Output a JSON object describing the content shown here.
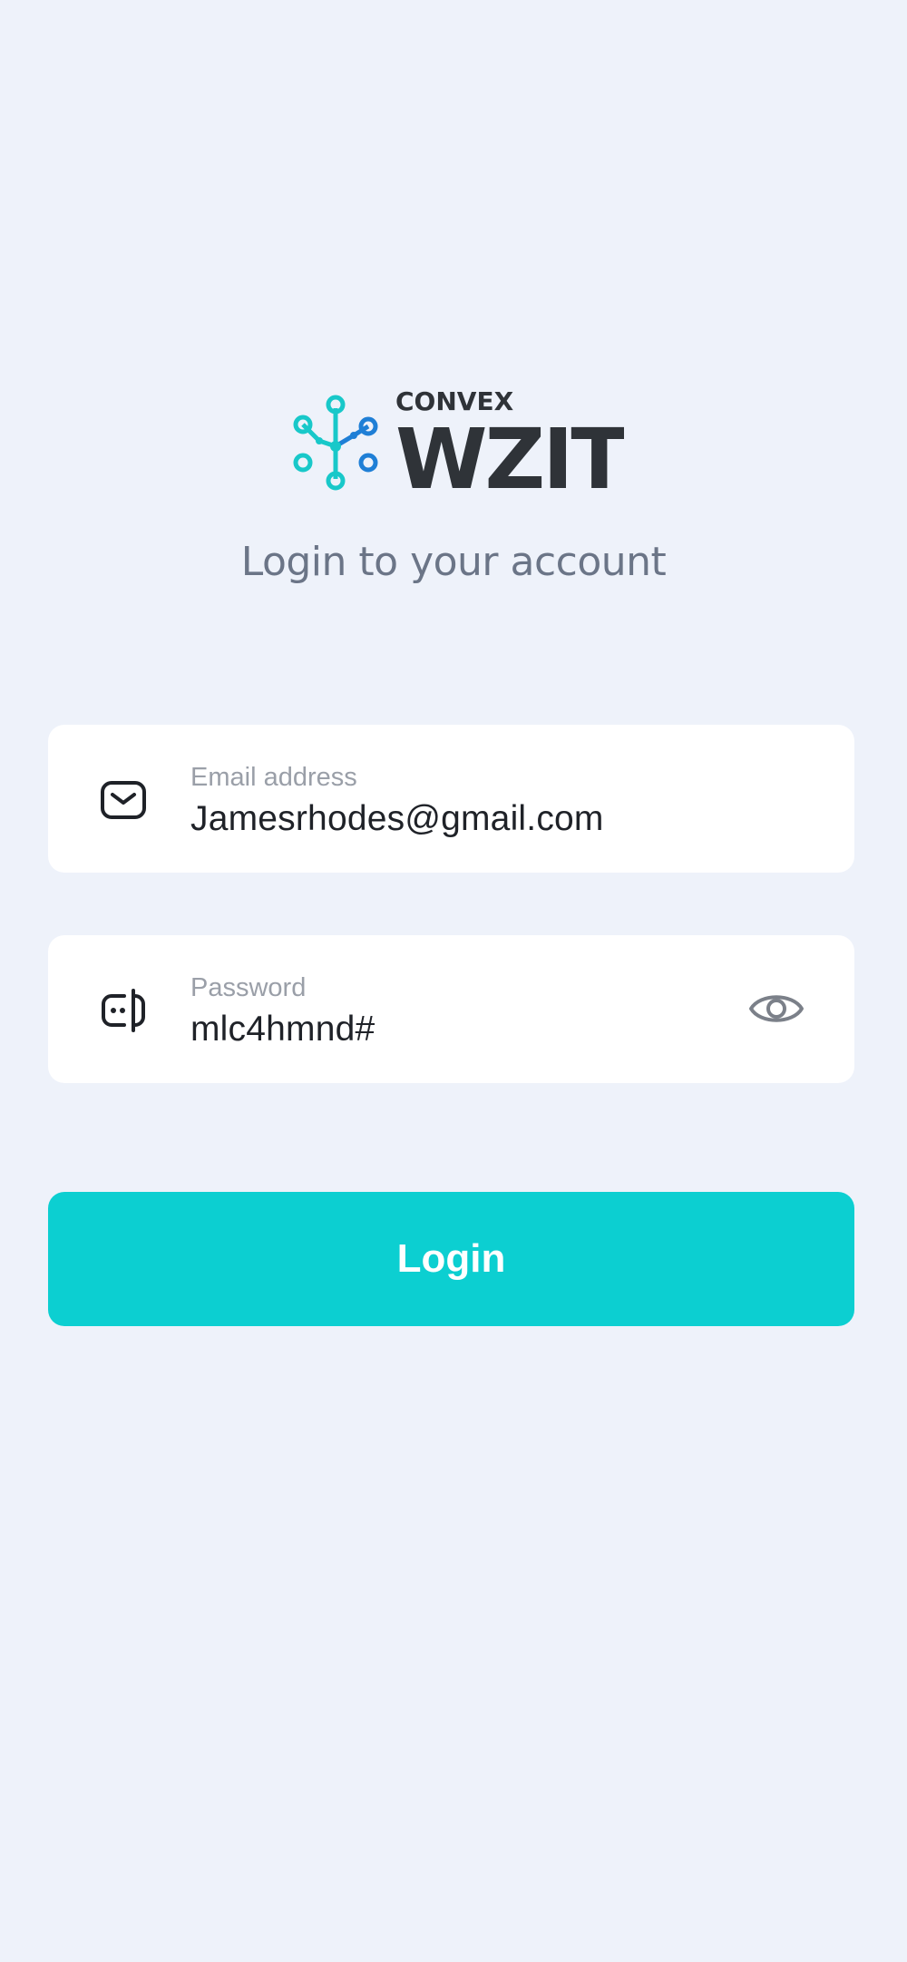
{
  "logo": {
    "top_word": "CONVEX",
    "main_word": "WZIT",
    "colors": {
      "cyan": "#18c8c9",
      "blue": "#1f7fd6",
      "dark": "#2f3338"
    }
  },
  "header": {
    "subtitle": "Login to your account"
  },
  "email": {
    "label": "Email address",
    "value": "Jamesrhodes@gmail.com",
    "icon": "mail-icon"
  },
  "password": {
    "label": "Password",
    "value": "mlc4hmnd#",
    "icon": "password-icon",
    "toggle_icon": "eye-icon"
  },
  "login": {
    "label": "Login",
    "color": "#0ccfd1"
  }
}
